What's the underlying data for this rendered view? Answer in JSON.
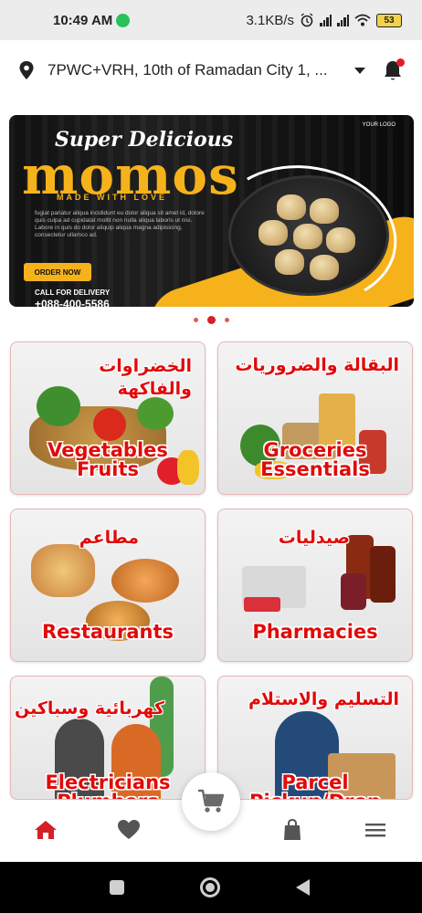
{
  "status_bar": {
    "time": "10:49 AM",
    "network_speed": "3.1KB/s",
    "battery": "53"
  },
  "location": {
    "address": "7PWC+VRH, 10th of Ramadan City 1, ..."
  },
  "banner": {
    "headline": "Super Delicious",
    "title": "momos",
    "tagline": "MADE WITH LOVE",
    "body_text": "fugiat pariatur aliqua incididunt eu dolor aliqua sit amet id, dolore quis culpa ad cupidatat mollit non nulla aliqua laboris ut nisi. Labore in quis do dolor aliquip aliqua magna adipisicing, consectetur ullamco ad.",
    "order_button": "ORDER NOW",
    "call_label": "CALL FOR DELIVERY",
    "phone": "+088-400-5586",
    "logo": "YOUR LOGO"
  },
  "pager": {
    "count": 3,
    "active_index": 1
  },
  "categories": [
    {
      "arabic": "الخضراوات والفاكهة",
      "english_line1": "Vegetables",
      "english_line2": "Fruits"
    },
    {
      "arabic": "البقالة والضروريات",
      "english_line1": "Groceries",
      "english_line2": "Essentials"
    },
    {
      "arabic": "مطاعم",
      "english_line1": "Restaurants",
      "english_line2": ""
    },
    {
      "arabic": "صيدليات",
      "english_line1": "Pharmacies",
      "english_line2": ""
    },
    {
      "arabic": "كهربائية وسباكين",
      "english_line1": "Electricians",
      "english_line2": "Plumbers"
    },
    {
      "arabic": "التسليم والاستلام",
      "english_line1": "Parcel",
      "english_line2": "Pickup/Drop"
    }
  ],
  "bottom_nav": {
    "items": [
      "home-icon",
      "heart-icon",
      "shopping-bag-icon",
      "menu-icon"
    ],
    "active": "home-icon",
    "fab": "cart-icon"
  },
  "colors": {
    "accent": "#d61f26",
    "banner_gold": "#f6b21b",
    "text": "#222222"
  }
}
